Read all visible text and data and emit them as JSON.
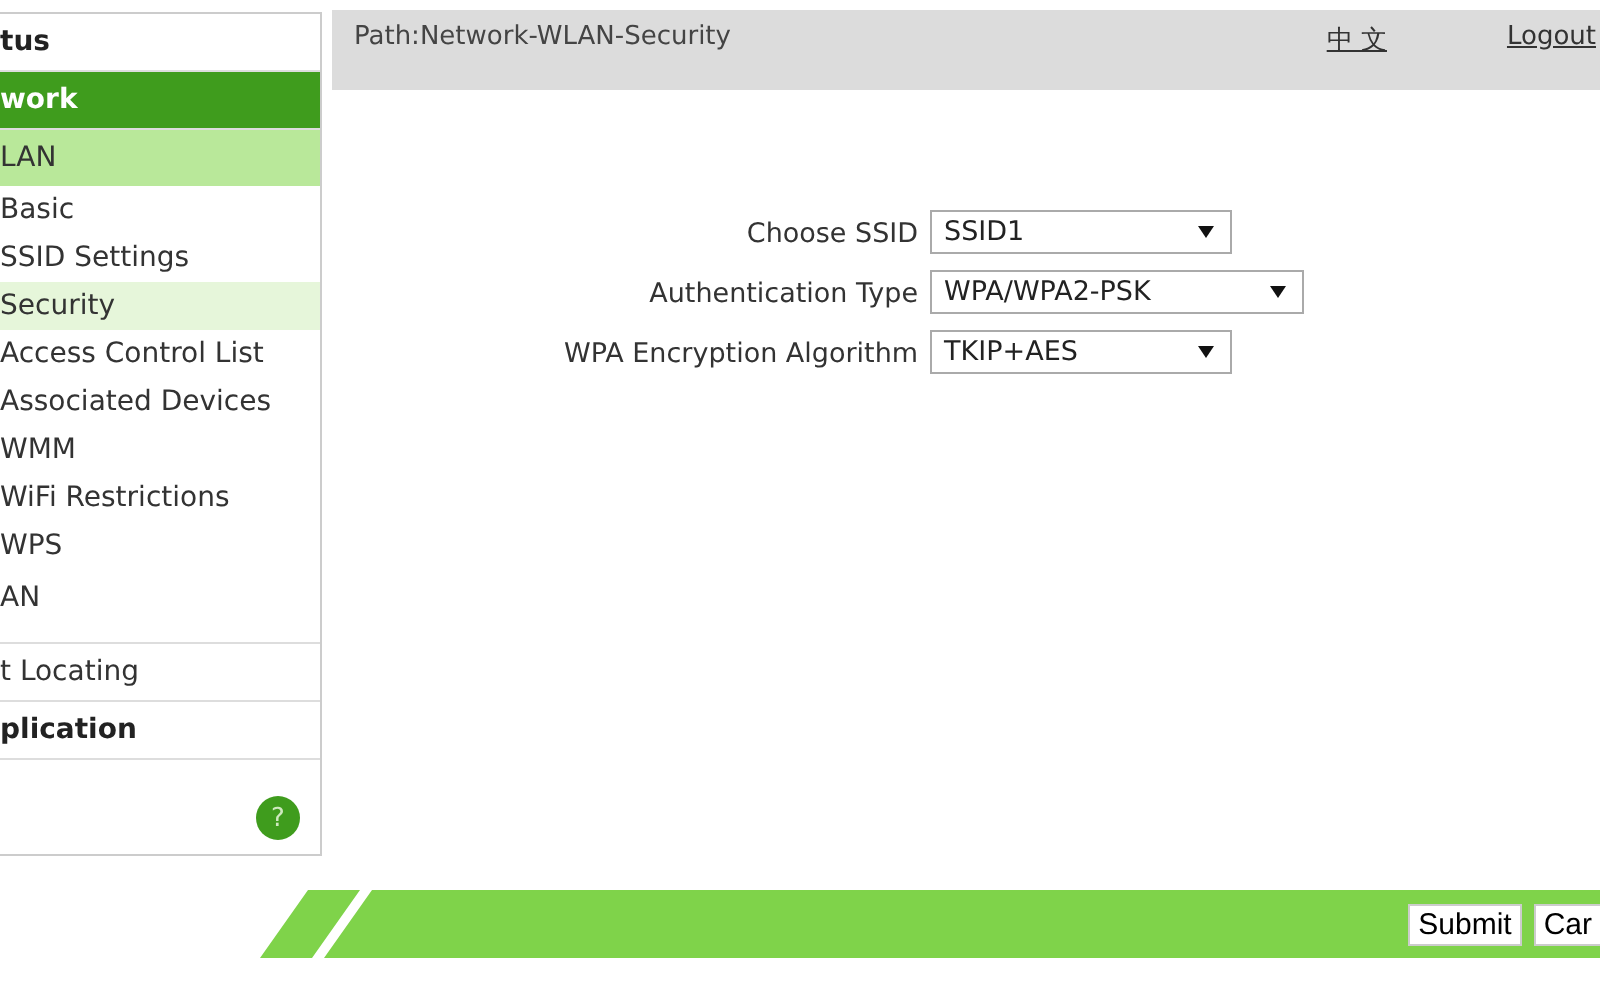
{
  "sidebar": {
    "items": [
      {
        "label": "tus",
        "kind": "section",
        "selected": false
      },
      {
        "label": "work",
        "kind": "section",
        "selected": true,
        "children": [
          {
            "label": "LAN",
            "selected": true,
            "children": [
              {
                "label": "Basic",
                "selected": false
              },
              {
                "label": "SSID Settings",
                "selected": false
              },
              {
                "label": "Security",
                "selected": true
              },
              {
                "label": "Access Control List",
                "selected": false
              },
              {
                "label": "Associated Devices",
                "selected": false
              },
              {
                "label": "WMM",
                "selected": false
              },
              {
                "label": "WiFi Restrictions",
                "selected": false
              },
              {
                "label": "WPS",
                "selected": false
              }
            ]
          },
          {
            "label": "AN",
            "selected": false
          }
        ]
      },
      {
        "label": "t Locating",
        "kind": "link",
        "selected": false
      },
      {
        "label": "plication",
        "kind": "section",
        "selected": false
      }
    ],
    "help": "?"
  },
  "header": {
    "path": "Path:Network-WLAN-Security",
    "language": "中 文",
    "logout": "Logout"
  },
  "form": {
    "fields": [
      {
        "label": "Choose SSID",
        "value": "SSID1"
      },
      {
        "label": "Authentication Type",
        "value": "WPA/WPA2-PSK"
      },
      {
        "label": "WPA Encryption Algorithm",
        "value": "TKIP+AES"
      }
    ]
  },
  "buttons": [
    "Submit",
    "Car"
  ]
}
